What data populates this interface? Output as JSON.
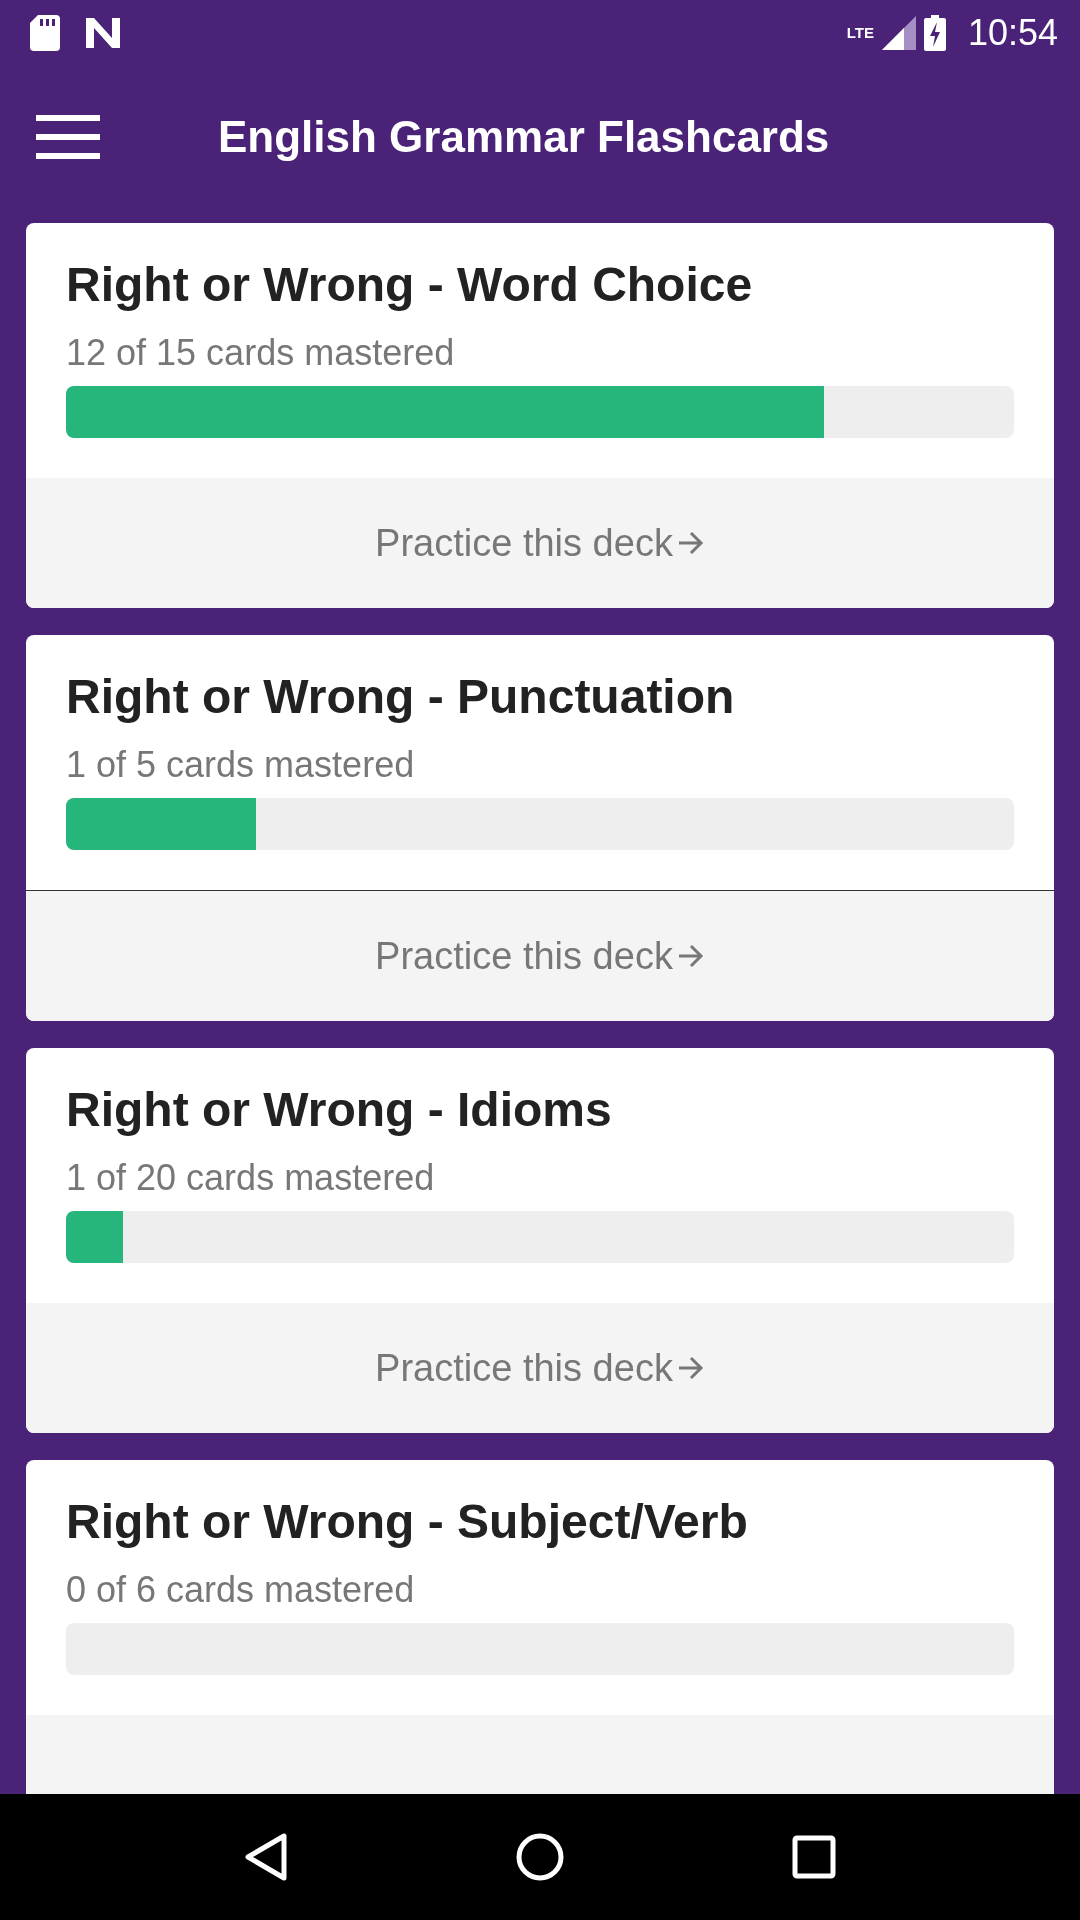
{
  "status_bar": {
    "network": "LTE",
    "time": "10:54"
  },
  "app_bar": {
    "title": "English Grammar Flashcards"
  },
  "decks": [
    {
      "title": "Right or Wrong - Word Choice",
      "progress": "12 of 15 cards mastered",
      "level": 0.8,
      "divider": false,
      "action": "Practice this deck"
    },
    {
      "title": "Right or Wrong - Punctuation",
      "progress": "1 of 5 cards mastered",
      "level": 0.2,
      "divider": true,
      "action": "Practice this deck"
    },
    {
      "title": "Right or Wrong - Idioms",
      "progress": "1 of 20 cards mastered",
      "level": 0.06,
      "divider": false,
      "action": "Practice this deck"
    },
    {
      "title": "Right or Wrong - Subject/Verb",
      "progress": "0 of 6 cards mastered",
      "divider": false
    }
  ]
}
